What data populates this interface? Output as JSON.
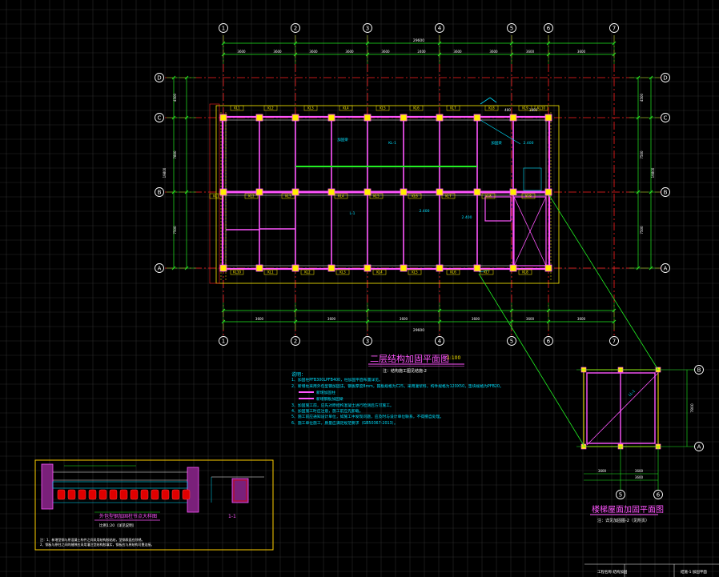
{
  "colors": {
    "background": "#000000",
    "grid": "#2a2a2a",
    "axis": "#ff2020",
    "dimension": "#22ee22",
    "wall": "#ff55ff",
    "column": "#ffee00",
    "room": "#ffffff",
    "annotation": "#00e0ff",
    "title": "#ff55ff",
    "detail_frame": "#ffd000",
    "detail_fill": "#e00000"
  },
  "main_plan": {
    "title": "二层结构加固平面图",
    "title_scale": "1:100",
    "title_sub": "注：结构施工图见结施-2",
    "column_axes": [
      "1",
      "2",
      "3",
      "4",
      "5",
      "6",
      "7"
    ],
    "row_axes": [
      "D",
      "C",
      "B",
      "A"
    ],
    "top_dims": [
      "3600",
      "3600",
      "3600",
      "3600",
      "3600",
      "2400",
      "3600"
    ],
    "top_total": "29600",
    "bottom_dims": [
      "3600",
      "3600",
      "3600",
      "3600",
      "3600",
      "3600"
    ],
    "bottom_total": "29600",
    "left_dims": [
      "4500",
      "7800",
      "7500"
    ],
    "left_total": "19800",
    "right_dims": [
      "4500",
      "7500",
      "7500"
    ],
    "right_total": "19800",
    "small_dims": [
      "400",
      "1800"
    ],
    "room_labels": [
      "KL1",
      "KL2",
      "KL3",
      "KL4",
      "KL5",
      "KL6",
      "KL7",
      "KL8",
      "KL9",
      "KL10"
    ],
    "tags": [
      "加固梁",
      "KL-1",
      "L-1",
      "2.400",
      "2.400",
      "2.400"
    ]
  },
  "notes": {
    "heading": "说明：",
    "items": [
      "1、加固柱PFB300LPFB400，柱加固平面布置详见。",
      "2、新增柱采用外包型钢加固法，钢板厚度8mm，箍板规格为C25，采用灌浆料，构件规格为120X50，垫块规格为PFB20。",
      "── 新增加固柱",
      "── 新增钢板加固梁",
      "3、加固施工前，应先对原结构混凝土进行检测后方可施工。",
      "4、加固施工时应注意，施工前应先卸载。",
      "5、施工前应通知设计单位，如施工中发现问题，应及时与设计单位联系，不得擅自处理。",
      "6、施工单位施工，质量应满足规范要求（GB50367-2013）。"
    ]
  },
  "inset_plan": {
    "title": "楼梯屋面加固平面图",
    "subtitle": "注：详见加固图-2（见附页）",
    "row_axes": [
      "B",
      "A"
    ],
    "column_axes": [
      "5",
      "6"
    ],
    "side_dim": "7800",
    "bottom_dims": [
      "3600",
      "3600"
    ],
    "bottom_total": "3600",
    "diag_tag": "LL-1"
  },
  "detail": {
    "title": "外包型钢加固柱节点大样图",
    "title_sub": "比例1:20（详见说明）",
    "section_label": "1-1",
    "note_lines": [
      "注：1、新增型钢与原混凝土构件之间采用结构胶粘结，型钢表面应除锈。",
      "2、钢板与原柱之间的缝隙应采用灌注型结构胶填实，钢板应与原结构可靠连接。"
    ]
  },
  "title_block": {
    "items": [
      "工程名称 结构加固",
      "结施-1 加固平面"
    ]
  }
}
